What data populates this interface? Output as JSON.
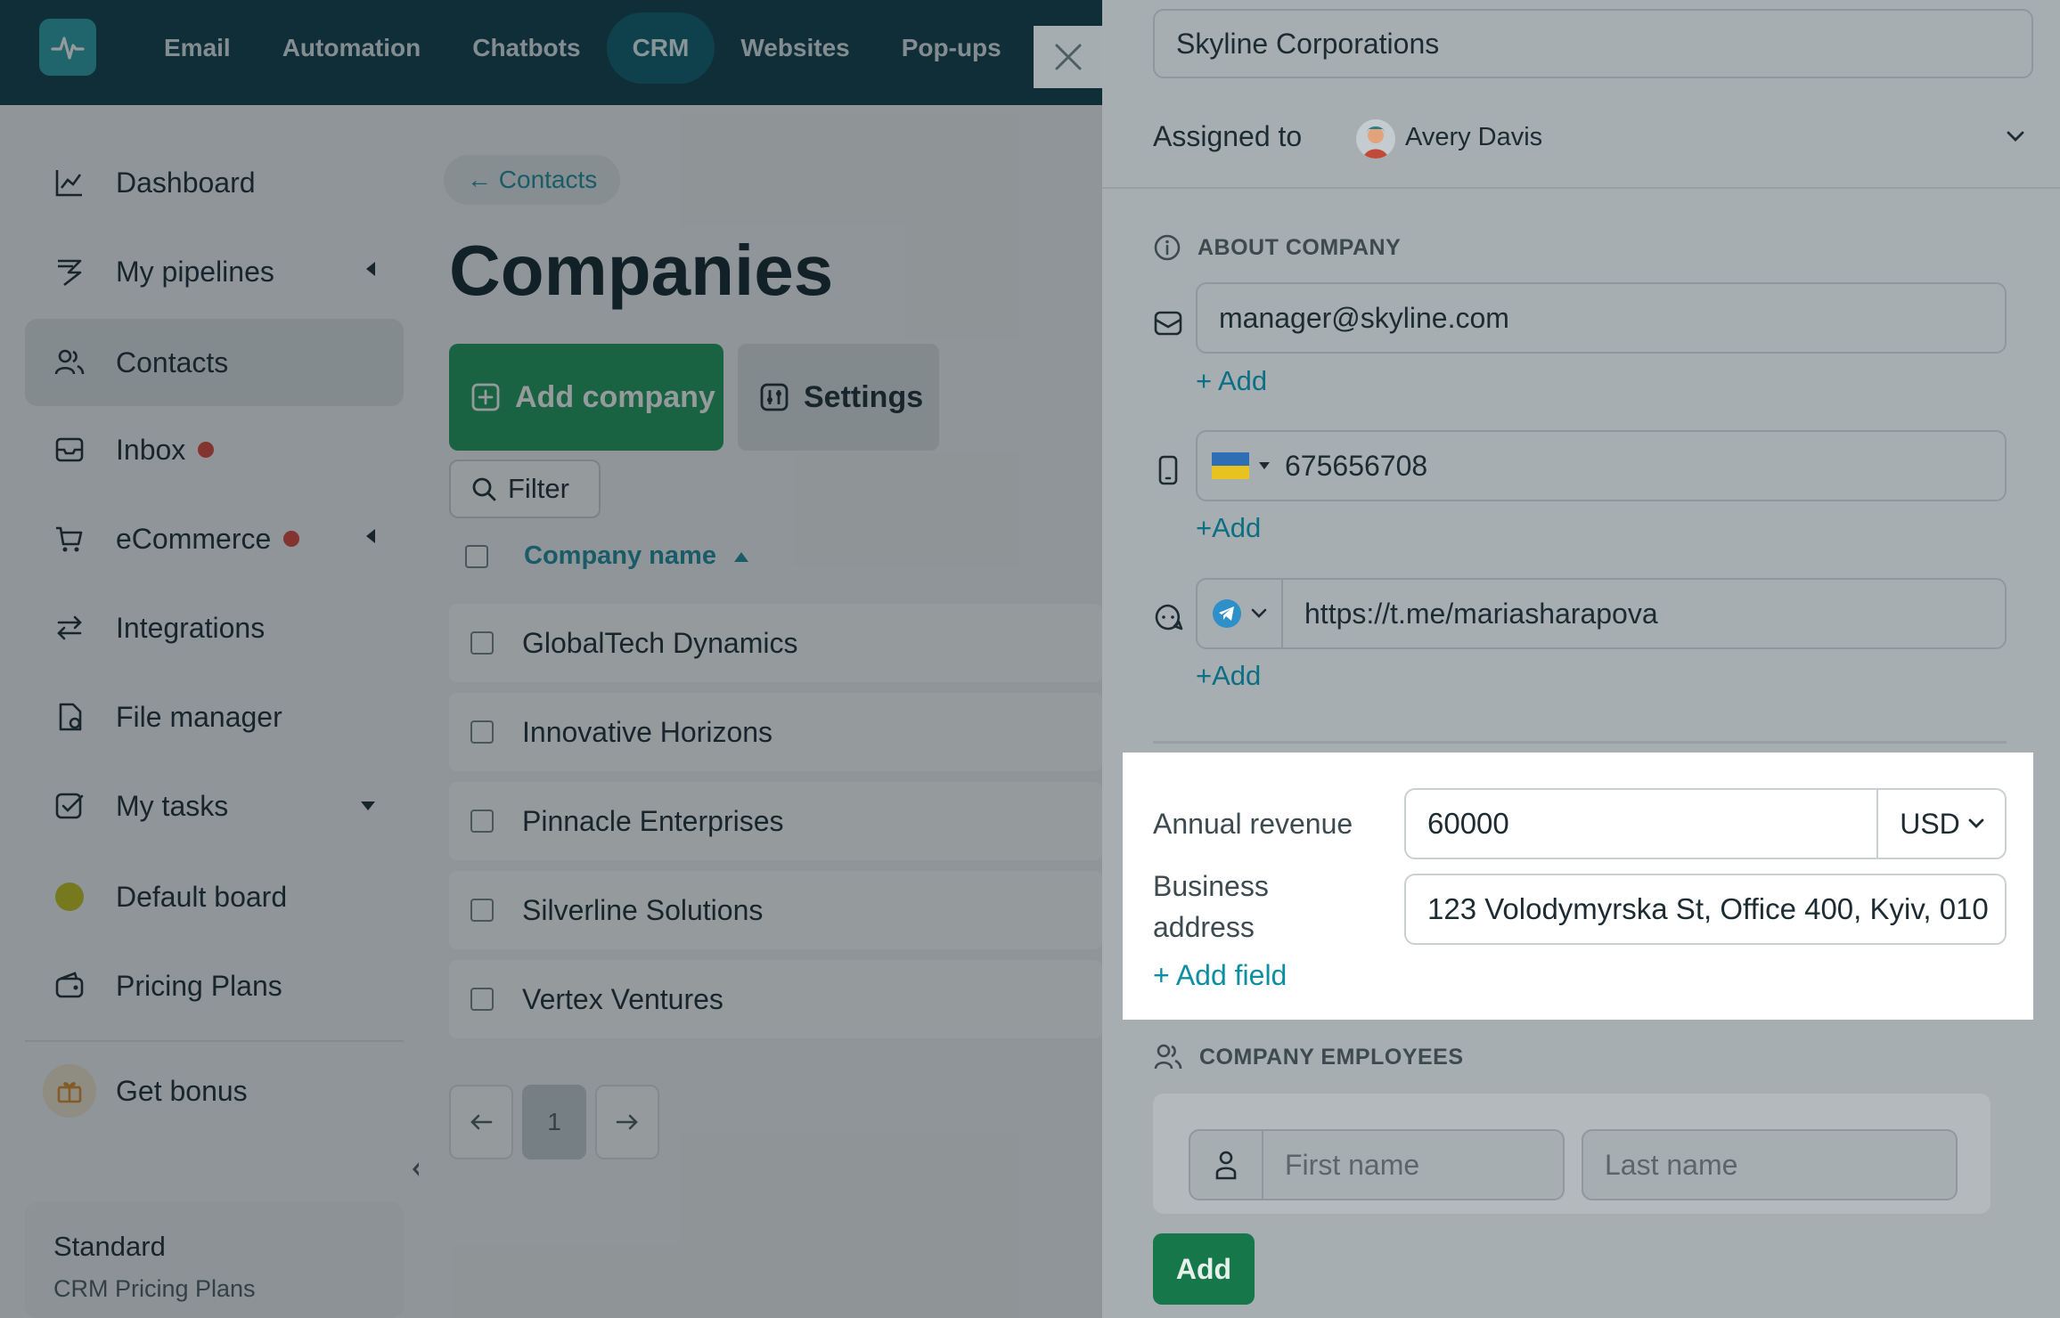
{
  "topnav": {
    "items": [
      {
        "label": "Email"
      },
      {
        "label": "Automation"
      },
      {
        "label": "Chatbots"
      },
      {
        "label": "CRM",
        "active": true
      },
      {
        "label": "Websites"
      },
      {
        "label": "Pop-ups"
      }
    ]
  },
  "sidebar": {
    "items": [
      {
        "label": "Dashboard",
        "icon": "chart-line-icon"
      },
      {
        "label": "My pipelines",
        "icon": "pipeline-icon"
      },
      {
        "label": "Contacts",
        "icon": "users-icon",
        "active": true
      },
      {
        "label": "Inbox",
        "icon": "inbox-icon"
      },
      {
        "label": "eCommerce",
        "icon": "cart-icon"
      },
      {
        "label": "Integrations",
        "icon": "arrows-exchange-icon"
      },
      {
        "label": "File manager",
        "icon": "file-icon"
      },
      {
        "label": "My tasks",
        "icon": "task-check-icon"
      },
      {
        "label": "Default board",
        "icon": "board-dot-icon"
      },
      {
        "label": "Pricing Plans",
        "icon": "wallet-icon"
      },
      {
        "label": "Get bonus",
        "icon": "gift-icon"
      }
    ],
    "plan": {
      "title": "Standard",
      "subtitle": "CRM Pricing Plans"
    }
  },
  "main": {
    "back_label": "← Contacts",
    "title": "Companies",
    "add_company_label": "Add company",
    "settings_label": "Settings",
    "filter_label": "Filter",
    "column_header": "Company name",
    "rows": [
      "GlobalTech Dynamics",
      "Innovative Horizons",
      "Pinnacle Enterprises",
      "Silverline Solutions",
      "Vertex Ventures"
    ],
    "pager": {
      "current_page": "1"
    }
  },
  "drawer": {
    "company_name_value": "Skyline Corporations",
    "assigned_label": "Assigned to",
    "assigned_user": "Avery Davis",
    "about_heading": "ABOUT COMPANY",
    "email_value": "manager@skyline.com",
    "email_add": "+ Add",
    "phone_value": "675656708",
    "phone_add": "+Add",
    "messenger_value": "https://t.me/mariasharapova",
    "messenger_add": "+Add",
    "annual_revenue_label": "Annual revenue",
    "annual_revenue_value": "60000",
    "currency": "USD",
    "business_address_label_1": "Business",
    "business_address_label_2": "address",
    "business_address_value": "123 Volodymyrska St, Office 400, Kyiv, 010",
    "add_field_label": "+ Add field",
    "employees_heading": "COMPANY EMPLOYEES",
    "first_name_placeholder": "First name",
    "last_name_placeholder": "Last name",
    "add_employee_label": "Add"
  },
  "colors": {
    "topbar": "#0e3b4a",
    "accent_green": "#1e9a5b",
    "link_teal": "#1e8ea0",
    "badge_red": "#e0453b"
  }
}
